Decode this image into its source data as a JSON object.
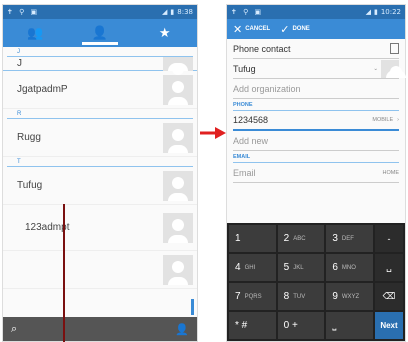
{
  "left": {
    "status_time": "8:38",
    "tabs": [
      "👥",
      "👤",
      "★"
    ],
    "sections": [
      {
        "letter": "J",
        "contacts": [
          "J",
          "JgatpadmP"
        ]
      },
      {
        "letter": "R",
        "contacts": [
          "Rugg"
        ]
      },
      {
        "letter": "T",
        "contacts": [
          "Tufug",
          "123admpt",
          ""
        ]
      }
    ]
  },
  "right": {
    "status_time": "10:22",
    "cancel_label": "CANCEL",
    "done_label": "DONE",
    "account_label": "Phone contact",
    "name_value": "Tufug",
    "organization_placeholder": "Add organization",
    "phone_header": "PHONE",
    "phone_value": "1234568",
    "phone_type": "MOBILE",
    "add_new_label": "Add new",
    "email_header": "EMAIL",
    "email_placeholder": "Email",
    "email_type": "HOME",
    "keys": [
      {
        "main": "1",
        "sub": ""
      },
      {
        "main": "2",
        "sub": "ABC"
      },
      {
        "main": "3",
        "sub": "DEF"
      },
      {
        "main": "-",
        "sub": ""
      },
      {
        "main": "4",
        "sub": "GHI"
      },
      {
        "main": "5",
        "sub": "JKL"
      },
      {
        "main": "6",
        "sub": "MNO"
      },
      {
        "main": "␣",
        "sub": ""
      },
      {
        "main": "7",
        "sub": "PQRS"
      },
      {
        "main": "8",
        "sub": "TUV"
      },
      {
        "main": "9",
        "sub": "WXYZ"
      },
      {
        "main": "⌫",
        "sub": ""
      },
      {
        "main": "* #",
        "sub": ""
      },
      {
        "main": "0 +",
        "sub": ""
      },
      {
        "main": "⎵",
        "sub": ""
      },
      {
        "main": "Next",
        "sub": ""
      }
    ]
  },
  "colors": {
    "accent": "#3a8bd6",
    "arrow": "#e02020"
  }
}
